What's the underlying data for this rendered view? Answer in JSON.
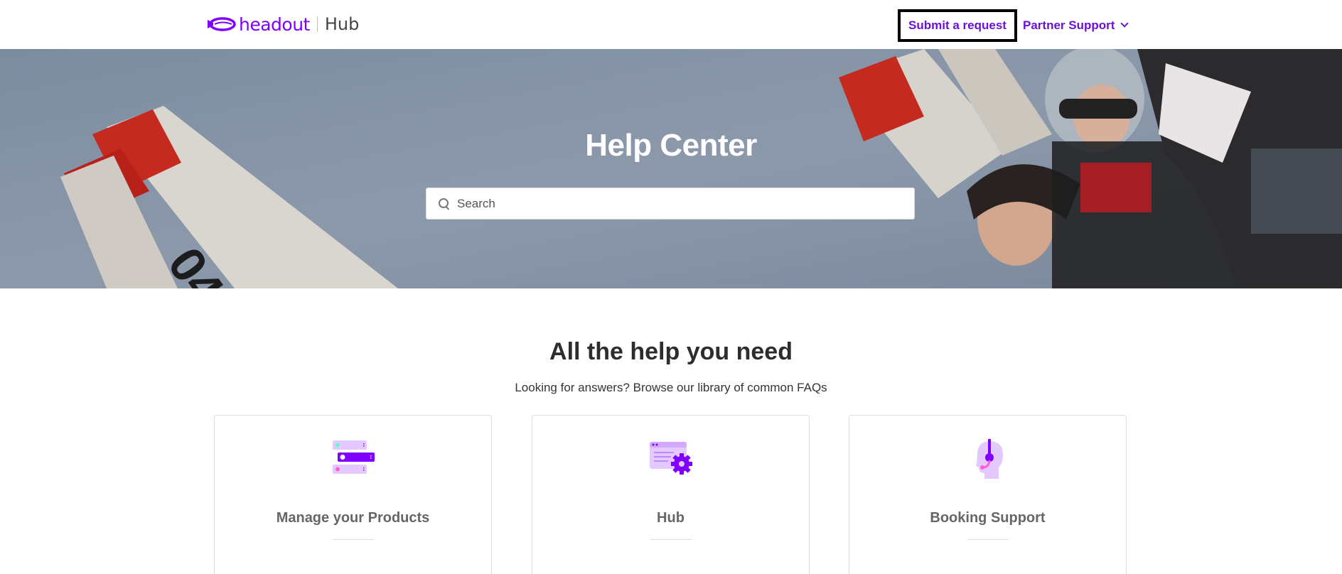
{
  "header": {
    "logo_text": "headout",
    "logo_hub": "Hub",
    "submit_label": "Submit a request",
    "partner_label": "Partner Support"
  },
  "hero": {
    "title": "Help Center",
    "search_placeholder": "Search"
  },
  "main": {
    "title": "All the help you need",
    "subtitle": "Looking for answers? Browse our library of common FAQs",
    "cards": [
      {
        "label": "Manage your Products",
        "icon": "product-list-icon"
      },
      {
        "label": "Hub",
        "icon": "settings-window-icon"
      },
      {
        "label": "Booking Support",
        "icon": "headset-support-icon"
      }
    ]
  },
  "colors": {
    "brand": "#8000ff",
    "link": "#6b12d9",
    "icon_light": "#e3c9ff",
    "icon_dark": "#8000ff",
    "icon_pink": "#ff5fd6"
  }
}
